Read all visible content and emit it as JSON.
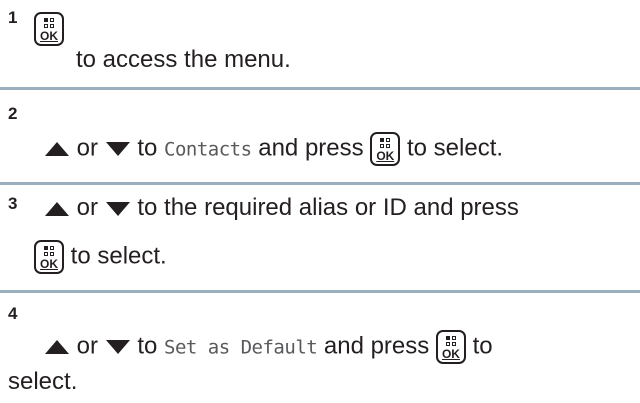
{
  "ok_button": {
    "label": "OK"
  },
  "steps": [
    {
      "number": "1",
      "text_a": "to access the menu."
    },
    {
      "number": "2",
      "text_or": "or",
      "text_to": "to",
      "menu_item": "Contacts",
      "text_press": "and press",
      "text_end": "to select."
    },
    {
      "number": "3",
      "text_or": "or",
      "text_rest": "to the required alias or ID and press",
      "text_end": "to select."
    },
    {
      "number": "4",
      "text_or": "or",
      "text_to": "to",
      "menu_item": "Set as Default",
      "text_press": "and press",
      "text_end": "to",
      "text_end2": "select."
    }
  ]
}
